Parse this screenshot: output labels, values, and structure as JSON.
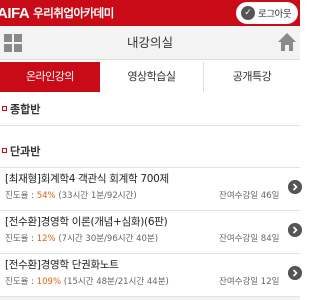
{
  "header": {
    "brand_latin": "AIFA",
    "brand_korean": "우리취업아카데미",
    "logout_label": "로그아웃",
    "accent_color": "#c90a17"
  },
  "titlebar": {
    "title": "내강의실",
    "menu_icon": "grid-icon",
    "home_icon": "home-icon"
  },
  "tabs": [
    {
      "label": "온라인강의",
      "active": true
    },
    {
      "label": "영상학습실",
      "active": false
    },
    {
      "label": "공개특강",
      "active": false
    }
  ],
  "sections": {
    "group": "종합반",
    "single": "단과반"
  },
  "courses": [
    {
      "title": "[최재형]회계학4 객관식 회계학 700제",
      "progress_label": "진도율 : ",
      "progress_pct": "54%",
      "progress_detail": " (33시간 1분/92시간)",
      "remaining": "잔여수강일 46일"
    },
    {
      "title": "[전수환]경영학 이론(개념+심화)(6판)",
      "progress_label": "진도율 : ",
      "progress_pct": "12%",
      "progress_detail": " (7시간 30분/96시간 40분)",
      "remaining": "잔여수강일 84일"
    },
    {
      "title": "[전수환]경영학 단권화노트",
      "progress_label": "진도율 : ",
      "progress_pct": "109%",
      "progress_detail": " (15시간 48분/21시간 44분)",
      "remaining": "잔여수강일 12일"
    }
  ]
}
